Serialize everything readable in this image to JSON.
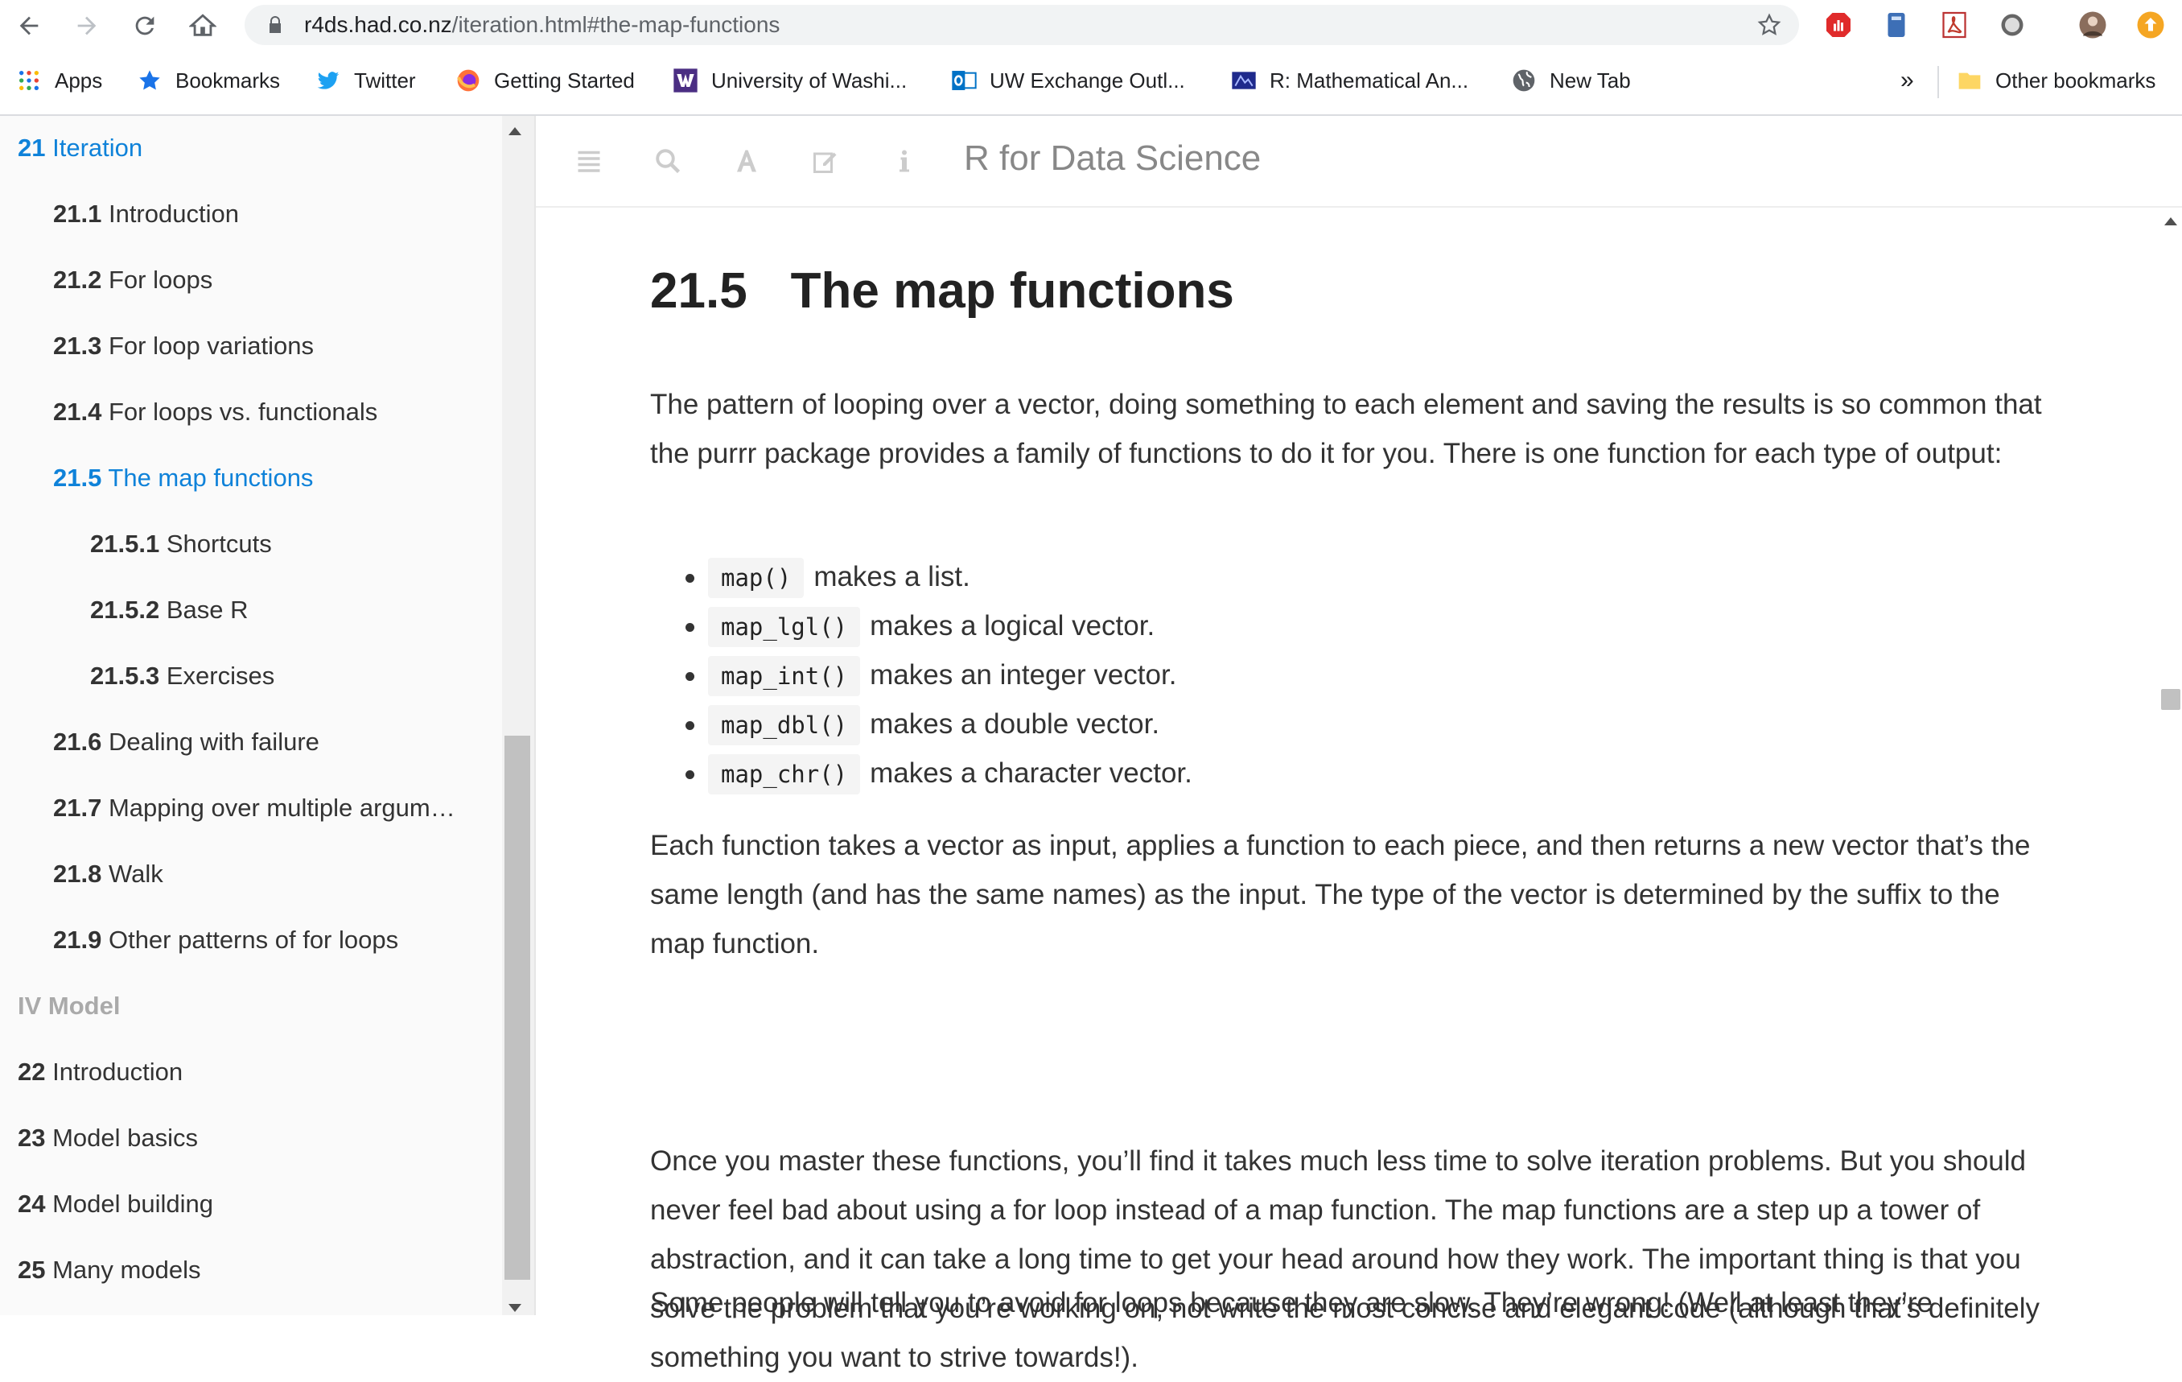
{
  "browser": {
    "url_host": "r4ds.had.co.nz",
    "url_path": "/iteration.html#the-map-functions",
    "bookmarks": [
      {
        "label": "Apps",
        "icon": "apps-grid-icon"
      },
      {
        "label": "Bookmarks",
        "icon": "star-icon"
      },
      {
        "label": "Twitter",
        "icon": "twitter-icon"
      },
      {
        "label": "Getting Started",
        "icon": "firefox-icon"
      },
      {
        "label": "University of Washi...",
        "icon": "uw-icon"
      },
      {
        "label": "UW Exchange Outl...",
        "icon": "outlook-icon"
      },
      {
        "label": "R: Mathematical An...",
        "icon": "r-doc-icon"
      },
      {
        "label": "New Tab",
        "icon": "globe-icon"
      }
    ],
    "overflow_label": "»",
    "other_bookmarks": "Other bookmarks"
  },
  "sidebar": {
    "items": [
      {
        "num": "21",
        "label": "Iteration",
        "level": 0,
        "active": true
      },
      {
        "num": "21.1",
        "label": "Introduction",
        "level": 1
      },
      {
        "num": "21.2",
        "label": "For loops",
        "level": 1
      },
      {
        "num": "21.3",
        "label": "For loop variations",
        "level": 1
      },
      {
        "num": "21.4",
        "label": "For loops vs. functionals",
        "level": 1
      },
      {
        "num": "21.5",
        "label": "The map functions",
        "level": 1,
        "active": true
      },
      {
        "num": "21.5.1",
        "label": "Shortcuts",
        "level": 2
      },
      {
        "num": "21.5.2",
        "label": "Base R",
        "level": 2
      },
      {
        "num": "21.5.3",
        "label": "Exercises",
        "level": 2
      },
      {
        "num": "21.6",
        "label": "Dealing with failure",
        "level": 1
      },
      {
        "num": "21.7",
        "label": "Mapping over multiple argum…",
        "level": 1
      },
      {
        "num": "21.8",
        "label": "Walk",
        "level": 1
      },
      {
        "num": "21.9",
        "label": "Other patterns of for loops",
        "level": 1
      },
      {
        "num": "",
        "label": "IV Model",
        "level": 0,
        "part": true
      },
      {
        "num": "22",
        "label": "Introduction",
        "level": 0
      },
      {
        "num": "23",
        "label": "Model basics",
        "level": 0
      },
      {
        "num": "24",
        "label": "Model building",
        "level": 0
      },
      {
        "num": "25",
        "label": "Many models",
        "level": 0
      }
    ]
  },
  "header": {
    "book_title": "R for Data Science"
  },
  "article": {
    "section_number": "21.5",
    "section_title": "The map functions",
    "para1": "The pattern of looping over a vector, doing something to each element and saving the results is so common that the purrr package provides a family of functions to do it for you. There is one function for each type of output:",
    "list": [
      {
        "code": "map()",
        "text": "makes a list."
      },
      {
        "code": "map_lgl()",
        "text": "makes a logical vector."
      },
      {
        "code": "map_int()",
        "text": "makes an integer vector."
      },
      {
        "code": "map_dbl()",
        "text": "makes a double vector."
      },
      {
        "code": "map_chr()",
        "text": "makes a character vector."
      }
    ],
    "para2": "Each function takes a vector as input, applies a function to each piece, and then returns a new vector that’s the same length (and has the same names) as the input. The type of the vector is determined by the suffix to the map function.",
    "para3": "Once you master these functions, you’ll find it takes much less time to solve iteration problems. But you should never feel bad about using a for loop instead of a map function. The map functions are a step up a tower of abstraction, and it can take a long time to get your head around how they work. The important thing is that you solve the problem that you’re working on, not write the most concise and elegant code (although that’s definitely something you want to strive towards!).",
    "para4": "Some people will tell you to avoid for loops because they are slow. They’re wrong! (Well at least they’re"
  }
}
